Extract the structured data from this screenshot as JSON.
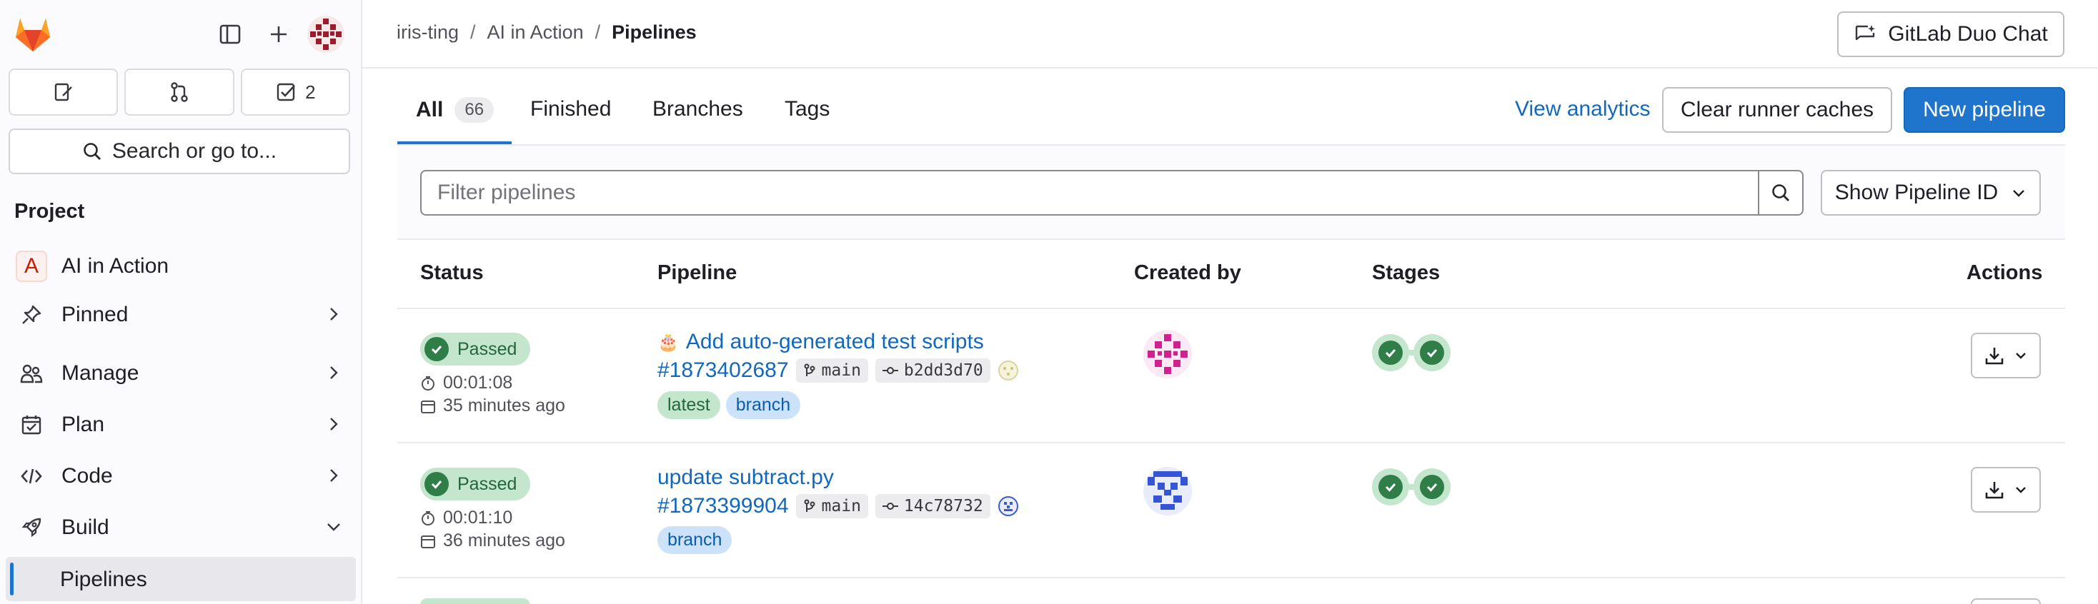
{
  "colors": {
    "accent": "#1f75cb",
    "success": "#2f7d47",
    "success_bg": "#c3e6cd",
    "sidebar_bg": "#fbfafd"
  },
  "sidebar": {
    "logo_icon": "gitlab-tanuki-icon",
    "toggle_icon": "sidebar-toggle-icon",
    "new_icon": "plus-icon",
    "counters": [
      {
        "icon": "issues-icon",
        "count": ""
      },
      {
        "icon": "merge-request-icon",
        "count": ""
      },
      {
        "icon": "todo-icon",
        "count": "2"
      }
    ],
    "search_label": "Search or go to...",
    "section_title": "Project",
    "project_initial": "A",
    "items": [
      {
        "label": "AI in Action",
        "icon": "project-badge"
      },
      {
        "label": "Pinned",
        "icon": "pin-icon"
      },
      {
        "label": "Manage",
        "icon": "users-icon"
      },
      {
        "label": "Plan",
        "icon": "calendar-check-icon"
      },
      {
        "label": "Code",
        "icon": "code-icon"
      },
      {
        "label": "Build",
        "icon": "rocket-icon"
      },
      {
        "label": "Pipelines",
        "icon": ""
      }
    ]
  },
  "breadcrumb": {
    "items": [
      "iris-ting",
      "AI in Action",
      "Pipelines"
    ],
    "separator": "/"
  },
  "duo_chat_label": "GitLab Duo Chat",
  "tabs": [
    {
      "label": "All",
      "count": "66",
      "active": true
    },
    {
      "label": "Finished"
    },
    {
      "label": "Branches"
    },
    {
      "label": "Tags"
    }
  ],
  "actions": {
    "view_analytics": "View analytics",
    "clear_caches": "Clear runner caches",
    "new_pipeline": "New pipeline"
  },
  "filter": {
    "placeholder": "Filter pipelines",
    "show_id_label": "Show Pipeline ID"
  },
  "table": {
    "headers": [
      "Status",
      "Pipeline",
      "Created by",
      "Stages",
      "Actions"
    ],
    "rows": [
      {
        "status": "Passed",
        "duration": "00:01:08",
        "finished": "35 minutes ago",
        "title_emoji": "🎂",
        "title": "Add auto-generated test scripts",
        "pipeline_id": "#1873402687",
        "branch": "main",
        "commit": "b2dd3d70",
        "labels": [
          "latest",
          "branch"
        ],
        "stages": [
          "passed",
          "passed"
        ]
      },
      {
        "status": "Passed",
        "duration": "00:01:10",
        "finished": "36 minutes ago",
        "title_emoji": "",
        "title": "update subtract.py",
        "pipeline_id": "#1873399904",
        "branch": "main",
        "commit": "14c78732",
        "labels": [
          "branch"
        ],
        "stages": [
          "passed",
          "passed"
        ]
      }
    ]
  }
}
